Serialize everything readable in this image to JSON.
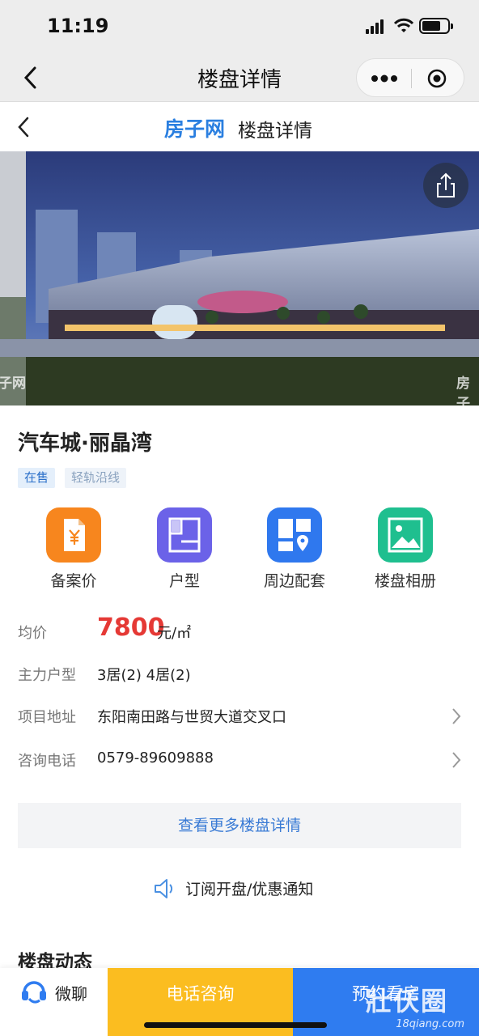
{
  "status": {
    "time": "11:19"
  },
  "wx_nav": {
    "title": "楼盘详情"
  },
  "site": {
    "logo": "房子网",
    "title": "楼盘详情"
  },
  "banner": {
    "watermark_left": "子网",
    "watermark_right": "房子"
  },
  "project": {
    "name": "汽车城·丽晶湾",
    "tags": [
      "在售",
      "轻轨沿线"
    ]
  },
  "quick_actions": [
    {
      "label": "备案价",
      "icon": "yuan-document-icon",
      "color": "#f7861e"
    },
    {
      "label": "户型",
      "icon": "floorplan-icon",
      "color": "#6b62e8"
    },
    {
      "label": "周边配套",
      "icon": "map-grid-icon",
      "color": "#2f78ee"
    },
    {
      "label": "楼盘相册",
      "icon": "photo-album-icon",
      "color": "#1fbf8f"
    }
  ],
  "info": {
    "price_key": "均价",
    "price_value": "7800",
    "price_unit": "元/㎡",
    "layout_key": "主力户型",
    "layout_value": "3居(2) 4居(2)",
    "address_key": "项目地址",
    "address_value": "东阳南田路与世贸大道交叉口",
    "phone_key": "咨询电话",
    "phone_value": "0579-89609888"
  },
  "more_button": "查看更多楼盘详情",
  "subscribe": "订阅开盘/优惠通知",
  "section_title": "楼盘动态",
  "bottom": {
    "chat": "微聊",
    "call": "电话咨询",
    "visit": "预约看房"
  },
  "watermark": {
    "big": "壯仸圈",
    "small": "18qiang.com"
  },
  "colors": {
    "accent_blue": "#2f7cf0",
    "price_red": "#e53935",
    "call_yellow": "#fbbd20"
  }
}
